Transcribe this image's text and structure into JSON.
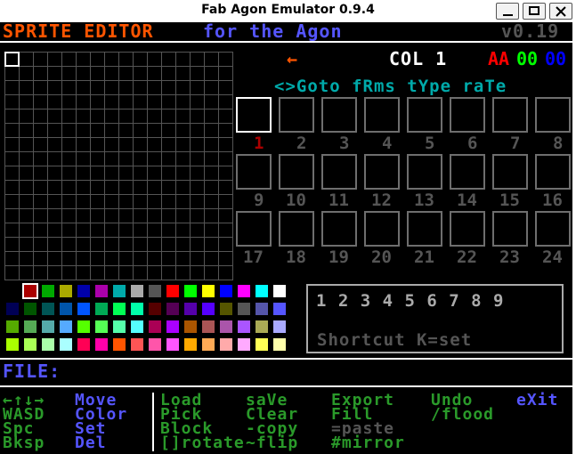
{
  "window": {
    "title": "Fab Agon Emulator 0.9.4"
  },
  "header": {
    "title_part1": "SPRITE EDITOR",
    "title_part2": "for the Agon",
    "version": "v0.19",
    "arrow": "←",
    "col_label": "COL 1",
    "rgb_r": "AA",
    "rgb_g": "00",
    "rgb_b": "00",
    "nav_line": "<>Goto fRms tYpe raTe"
  },
  "frames": [
    "1",
    "2",
    "3",
    "4",
    "5",
    "6",
    "7",
    "8",
    "9",
    "10",
    "11",
    "12",
    "13",
    "14",
    "15",
    "16",
    "17",
    "18",
    "19",
    "20",
    "21",
    "22",
    "23",
    "24"
  ],
  "shortcut": {
    "digits": "1 2 3 4 5 6 7 8 9",
    "hint": "Shortcut K=set"
  },
  "palette": [
    "#000000",
    "#aa0000",
    "#00aa00",
    "#aaaa00",
    "#0000aa",
    "#aa00aa",
    "#00aaaa",
    "#aaaaaa",
    "#555555",
    "#ff0000",
    "#00ff00",
    "#ffff00",
    "#0000ff",
    "#ff00ff",
    "#00ffff",
    "#ffffff",
    "#000055",
    "#005500",
    "#005555",
    "#0055aa",
    "#0055ff",
    "#00aa55",
    "#00ff55",
    "#00ffaa",
    "#550000",
    "#550055",
    "#5500aa",
    "#5500ff",
    "#555500",
    "#555555",
    "#5555aa",
    "#5555ff",
    "#55aa00",
    "#55aa55",
    "#55aaaa",
    "#55aaff",
    "#55ff00",
    "#55ff55",
    "#55ffaa",
    "#55ffff",
    "#aa0055",
    "#aa00ff",
    "#aa5500",
    "#aa5555",
    "#aa55aa",
    "#aa55ff",
    "#aaaa55",
    "#aaaaff",
    "#aaff00",
    "#aaff55",
    "#aaffaa",
    "#aaffff",
    "#ff0055",
    "#ff00aa",
    "#ff5500",
    "#ff5555",
    "#ff55aa",
    "#ff55ff",
    "#ffaa00",
    "#ffaa55",
    "#ffaaaa",
    "#ffaaff",
    "#ffff55",
    "#ffffaa"
  ],
  "file": {
    "label": "FILE:",
    "value": ""
  },
  "help": {
    "keys": [
      [
        "←↑↓→",
        "Move"
      ],
      [
        "WASD",
        "Color"
      ],
      [
        "Spc",
        "Set"
      ],
      [
        "Bksp",
        "Del"
      ]
    ],
    "commands": [
      [
        [
          "Load",
          "#2a9a2a"
        ],
        [
          "saVe",
          "#2a9a2a"
        ],
        [
          "Export",
          "#2a9a2a"
        ],
        [
          "Undo",
          "#2a9a2a"
        ],
        [
          "eXit",
          "#5555ff"
        ]
      ],
      [
        [
          "Pick",
          "#2a9a2a"
        ],
        [
          "Clear",
          "#2a9a2a"
        ],
        [
          "Fill",
          "#2a9a2a"
        ],
        [
          "/flood",
          "#2a9a2a"
        ]
      ],
      [
        [
          "Block",
          "#2a9a2a"
        ],
        [
          "-copy",
          "#2a9a2a"
        ],
        [
          "=paste",
          "#555555"
        ]
      ],
      [
        [
          "[]rotate",
          "#2a9a2a"
        ],
        [
          "~flip",
          "#2a9a2a"
        ],
        [
          "#mirror",
          "#2a9a2a"
        ]
      ]
    ]
  },
  "colors": {
    "orange": "#ff5500",
    "blue": "#5555ff",
    "green": "#2a9a2a",
    "grey": "#555555",
    "white": "#ffffff",
    "red": "#aa0000"
  }
}
